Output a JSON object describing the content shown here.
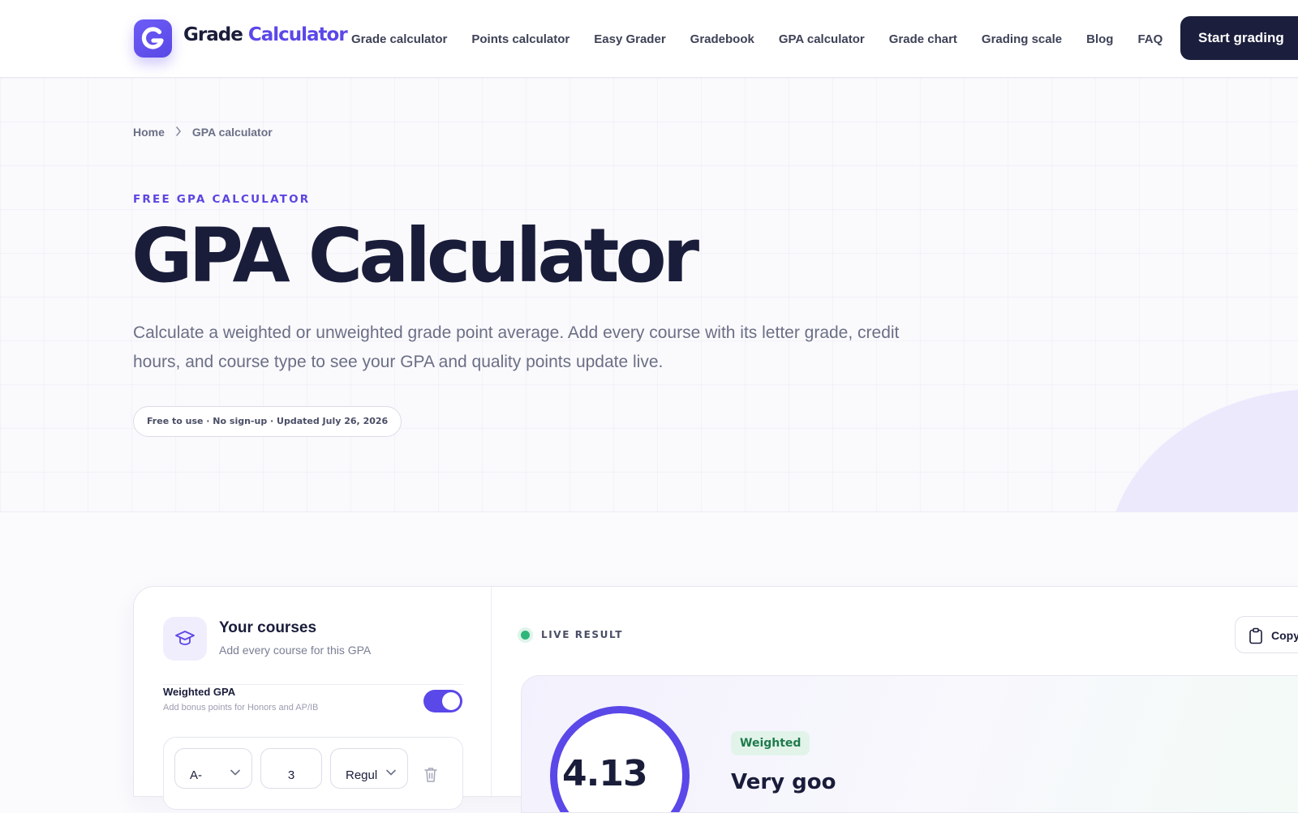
{
  "brand": {
    "name_a": "Grade",
    "name_b": "Calculator",
    "logo_letter": "G",
    "accent": "#5b48e8",
    "dark": "#1b1e3c"
  },
  "nav": {
    "links": [
      "Grade calculator",
      "Points calculator",
      "Easy Grader",
      "Gradebook",
      "GPA calculator",
      "Grade chart",
      "Grading scale",
      "Blog",
      "FAQ"
    ],
    "cta": "Start grading"
  },
  "breadcrumb": {
    "home": "Home",
    "current": "GPA calculator"
  },
  "hero": {
    "eyebrow": "FREE GPA CALCULATOR",
    "title": "GPA Calculator",
    "lead": "Calculate a weighted or unweighted grade point average. Add every course with its letter grade, credit hours, and course type to see your GPA and quality points update live.",
    "pill": "Free to use · No sign-up · Updated July 26, 2026"
  },
  "courses": {
    "title": "Your courses",
    "subtitle": "Add every course for this GPA",
    "weighted_label": "Weighted GPA",
    "weighted_hint": "Add bonus points for Honors and AP/IB",
    "weighted_on": true,
    "row": {
      "grade": "A-",
      "credits": "3",
      "type": "Regul"
    }
  },
  "result": {
    "live_label": "LIVE RESULT",
    "copy_label": "Copy",
    "gpa": "4.13",
    "badge": "Weighted",
    "headline": "Very goo"
  },
  "icons": [
    "graduation-cap-icon",
    "chevron-right-icon",
    "chevron-down-icon",
    "trash-icon",
    "clipboard-icon"
  ]
}
